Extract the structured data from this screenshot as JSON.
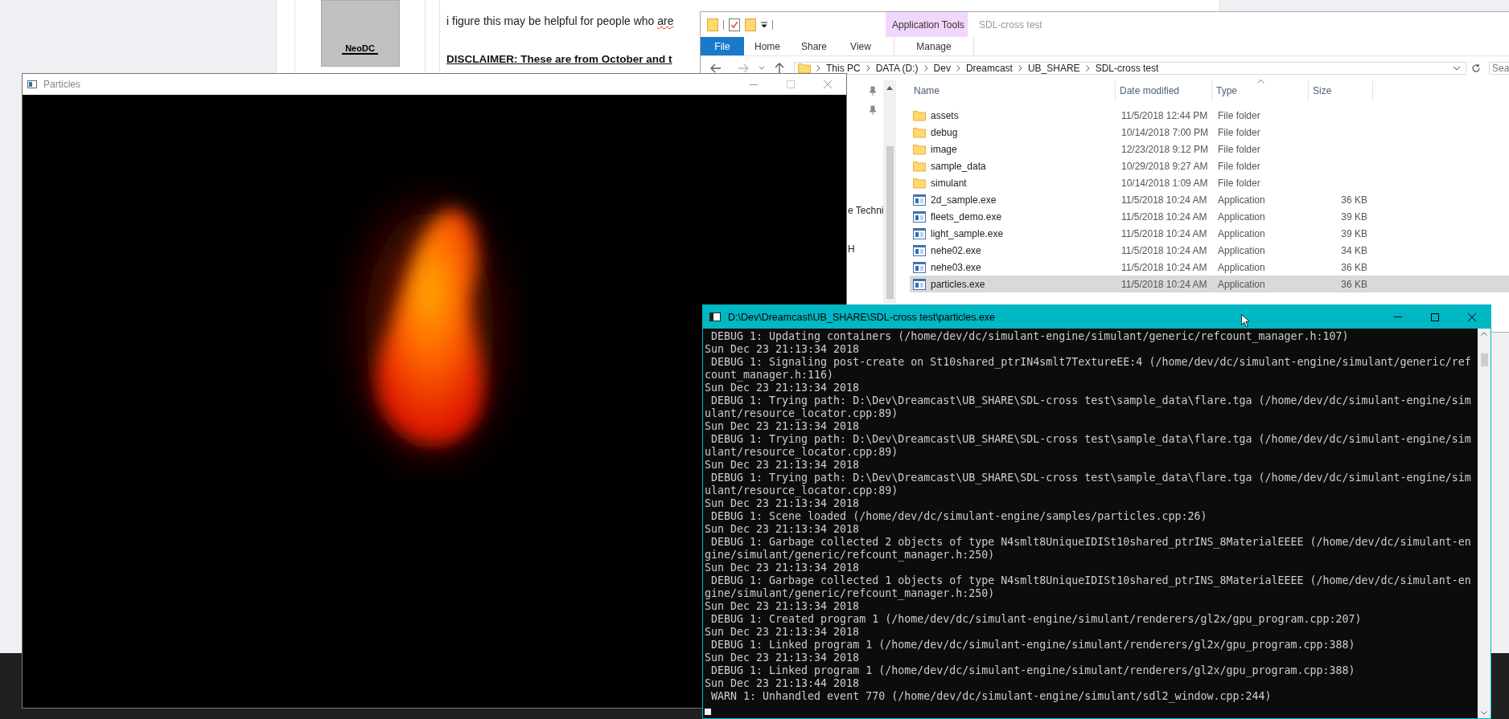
{
  "browser": {
    "avatar_name": "NeoDC",
    "post_line": {
      "text": "i figure this may be helpful for people who",
      "misspelled_word": "are"
    },
    "disclaimer": "DISCLAIMER: These are from October and t"
  },
  "explorer": {
    "context_header": "Application Tools",
    "title": "SDL-cross test",
    "ribbon_tabs": [
      {
        "label": "File",
        "kind": "file"
      },
      {
        "label": "Home",
        "kind": "tab"
      },
      {
        "label": "Share",
        "kind": "tab"
      },
      {
        "label": "View",
        "kind": "tab"
      },
      {
        "label": "Manage",
        "kind": "context"
      }
    ],
    "breadcrumb": [
      "This PC",
      "DATA (D:)",
      "Dev",
      "Dreamcast",
      "UB_SHARE",
      "SDL-cross test"
    ],
    "search_placeholder": "Sea",
    "nav_items": [
      "e Techni",
      "H"
    ],
    "columns": [
      "Name",
      "Date modified",
      "Type",
      "Size"
    ],
    "rows": [
      {
        "name": "assets",
        "date": "11/5/2018 12:44 PM",
        "type": "File folder",
        "kind": "folder",
        "selected": false
      },
      {
        "name": "debug",
        "date": "10/14/2018 7:00 PM",
        "type": "File folder",
        "kind": "folder",
        "selected": false
      },
      {
        "name": "image",
        "date": "12/23/2018 9:12 PM",
        "type": "File folder",
        "kind": "folder",
        "selected": false
      },
      {
        "name": "sample_data",
        "date": "10/29/2018 9:27 AM",
        "type": "File folder",
        "kind": "folder",
        "selected": false
      },
      {
        "name": "simulant",
        "date": "10/14/2018 1:09 AM",
        "type": "File folder",
        "kind": "folder",
        "selected": false
      },
      {
        "name": "2d_sample.exe",
        "date": "11/5/2018 10:24 AM",
        "type": "Application",
        "size": "36 KB",
        "kind": "application",
        "selected": false
      },
      {
        "name": "fleets_demo.exe",
        "date": "11/5/2018 10:24 AM",
        "type": "Application",
        "size": "39 KB",
        "kind": "application",
        "selected": false
      },
      {
        "name": "light_sample.exe",
        "date": "11/5/2018 10:24 AM",
        "type": "Application",
        "size": "39 KB",
        "kind": "application",
        "selected": false
      },
      {
        "name": "nehe02.exe",
        "date": "11/5/2018 10:24 AM",
        "type": "Application",
        "size": "34 KB",
        "kind": "application",
        "selected": false
      },
      {
        "name": "nehe03.exe",
        "date": "11/5/2018 10:24 AM",
        "type": "Application",
        "size": "36 KB",
        "kind": "application",
        "selected": false
      },
      {
        "name": "particles.exe",
        "date": "11/5/2018 10:24 AM",
        "type": "Application",
        "size": "36 KB",
        "kind": "application",
        "selected": true
      }
    ]
  },
  "particles_window": {
    "title": "Particles"
  },
  "console": {
    "title": "D:\\Dev\\Dreamcast\\UB_SHARE\\SDL-cross test\\particles.exe",
    "lines": [
      " DEBUG 1: Updating containers (/home/dev/dc/simulant-engine/simulant/generic/refcount_manager.h:107)",
      "Sun Dec 23 21:13:34 2018",
      " DEBUG 1: Signaling post-create on St10shared_ptrIN4smlt7TextureEE:4 (/home/dev/dc/simulant-engine/simulant/generic/refcount_manager.h:116)",
      "Sun Dec 23 21:13:34 2018",
      " DEBUG 1: Trying path: D:\\Dev\\Dreamcast\\UB_SHARE\\SDL-cross test\\sample_data\\flare.tga (/home/dev/dc/simulant-engine/simulant/resource_locator.cpp:89)",
      "Sun Dec 23 21:13:34 2018",
      " DEBUG 1: Trying path: D:\\Dev\\Dreamcast\\UB_SHARE\\SDL-cross test\\sample_data\\flare.tga (/home/dev/dc/simulant-engine/simulant/resource_locator.cpp:89)",
      "Sun Dec 23 21:13:34 2018",
      " DEBUG 1: Trying path: D:\\Dev\\Dreamcast\\UB_SHARE\\SDL-cross test\\sample_data\\flare.tga (/home/dev/dc/simulant-engine/simulant/resource_locator.cpp:89)",
      "Sun Dec 23 21:13:34 2018",
      " DEBUG 1: Scene loaded (/home/dev/dc/simulant-engine/samples/particles.cpp:26)",
      "Sun Dec 23 21:13:34 2018",
      " DEBUG 1: Garbage collected 2 objects of type N4smlt8UniqueIDISt10shared_ptrINS_8MaterialEEEE (/home/dev/dc/simulant-engine/simulant/generic/refcount_manager.h:250)",
      "Sun Dec 23 21:13:34 2018",
      " DEBUG 1: Garbage collected 1 objects of type N4smlt8UniqueIDISt10shared_ptrINS_8MaterialEEEE (/home/dev/dc/simulant-engine/simulant/generic/refcount_manager.h:250)",
      "Sun Dec 23 21:13:34 2018",
      " DEBUG 1: Created program 1 (/home/dev/dc/simulant-engine/simulant/renderers/gl2x/gpu_program.cpp:207)",
      "Sun Dec 23 21:13:34 2018",
      " DEBUG 1: Linked program 1 (/home/dev/dc/simulant-engine/simulant/renderers/gl2x/gpu_program.cpp:388)",
      "Sun Dec 23 21:13:34 2018",
      " DEBUG 1: Linked program 1 (/home/dev/dc/simulant-engine/simulant/renderers/gl2x/gpu_program.cpp:388)",
      "Sun Dec 23 21:13:44 2018",
      " WARN 1: Unhandled event 770 (/home/dev/dc/simulant-engine/simulant/sdl2_window.cpp:244)"
    ]
  }
}
